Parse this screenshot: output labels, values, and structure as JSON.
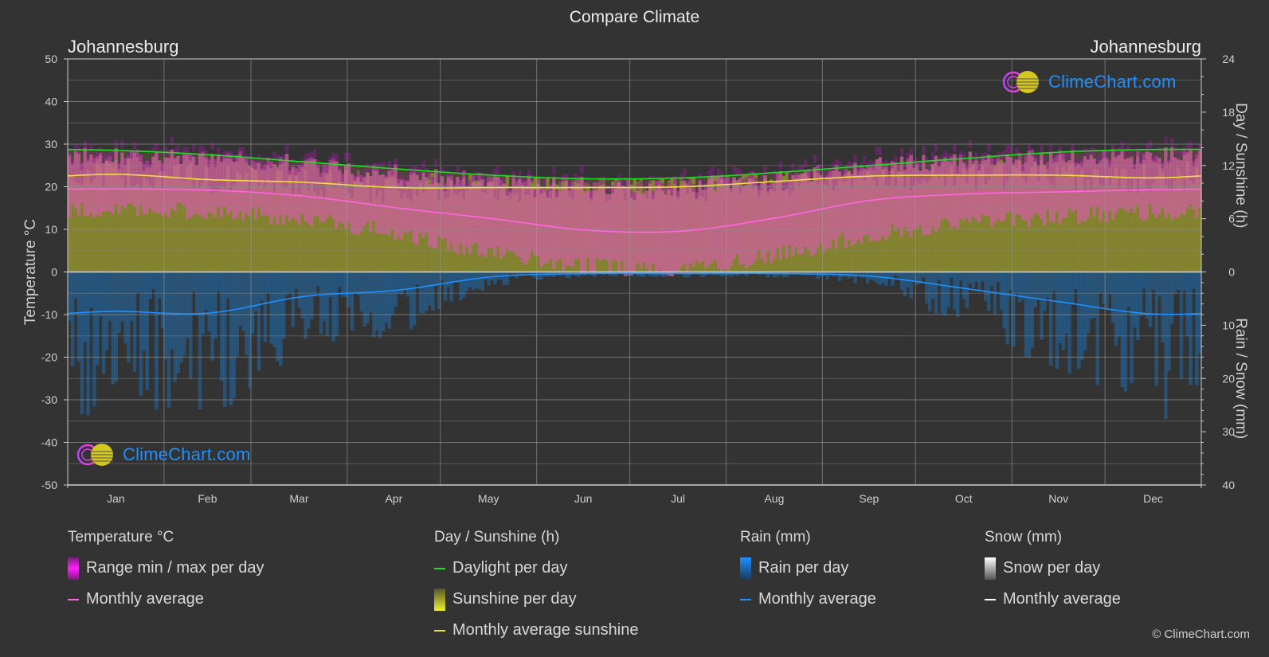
{
  "title": "Compare Climate",
  "city_left": "Johannesburg",
  "city_right": "Johannesburg",
  "watermark": "ClimeChart.com",
  "copyright": "© ClimeChart.com",
  "legend": {
    "temperature": {
      "title": "Temperature °C",
      "items": [
        {
          "label": "Range min / max per day",
          "color": "#e020e0"
        },
        {
          "label": "Monthly average",
          "color": "#ff66e0"
        }
      ]
    },
    "sunshine": {
      "title": "Day / Sunshine (h)",
      "items": [
        {
          "label": "Daylight per day",
          "color": "#22dd22"
        },
        {
          "label": "Sunshine per day",
          "color": "#e8e830"
        },
        {
          "label": "Monthly average sunshine",
          "color": "#f0e040"
        }
      ]
    },
    "rain": {
      "title": "Rain (mm)",
      "items": [
        {
          "label": "Rain per day",
          "color": "#1e90ff"
        },
        {
          "label": "Monthly average",
          "color": "#1e90ff"
        }
      ]
    },
    "snow": {
      "title": "Snow (mm)",
      "items": [
        {
          "label": "Snow per day",
          "color": "#ffffff"
        },
        {
          "label": "Monthly average",
          "color": "#ffffff"
        }
      ]
    }
  },
  "chart_data": {
    "type": "area",
    "title": "Compare Climate",
    "categories": [
      "Jan",
      "Feb",
      "Mar",
      "Apr",
      "May",
      "Jun",
      "Jul",
      "Aug",
      "Sep",
      "Oct",
      "Nov",
      "Dec"
    ],
    "y_left": {
      "label": "Temperature °C",
      "range": [
        -50,
        50
      ],
      "ticks": [
        50,
        40,
        30,
        20,
        10,
        0,
        -10,
        -20,
        -30,
        -40,
        -50
      ]
    },
    "y_right_top": {
      "label": "Day / Sunshine (h)",
      "range": [
        0,
        24
      ],
      "ticks": [
        24,
        18,
        12,
        6,
        0
      ]
    },
    "y_right_bottom": {
      "label": "Rain / Snow (mm)",
      "range": [
        0,
        40
      ],
      "ticks": [
        0,
        10,
        20,
        30,
        40
      ]
    },
    "grid": true,
    "series": [
      {
        "name": "Daylight per day (h)",
        "axis": "sunshine",
        "values": [
          13.7,
          13.2,
          12.4,
          11.6,
          10.9,
          10.5,
          10.6,
          11.2,
          12.0,
          12.8,
          13.5,
          13.8
        ]
      },
      {
        "name": "Monthly average sunshine (h)",
        "axis": "sunshine",
        "values": [
          11.0,
          10.4,
          10.1,
          9.5,
          9.5,
          9.5,
          9.6,
          10.2,
          10.8,
          10.9,
          10.9,
          10.6
        ]
      },
      {
        "name": "Temperature monthly average (°C)",
        "axis": "temperature",
        "values": [
          19.5,
          19.2,
          17.8,
          15.0,
          12.5,
          9.8,
          9.6,
          12.7,
          16.8,
          18.3,
          18.8,
          19.3
        ]
      },
      {
        "name": "Temperature daily max envelope (°C)",
        "axis": "temperature",
        "values": [
          26.5,
          26.0,
          24.8,
          22.5,
          20.5,
          19.5,
          19.5,
          21.5,
          24.0,
          25.5,
          26.0,
          26.5
        ]
      },
      {
        "name": "Temperature daily min envelope (°C)",
        "axis": "temperature",
        "values": [
          14.5,
          14.0,
          12.5,
          9.0,
          4.5,
          1.5,
          1.0,
          4.0,
          8.5,
          11.5,
          13.0,
          14.0
        ]
      },
      {
        "name": "Rain monthly average (mm)",
        "axis": "rain",
        "values": [
          7.4,
          7.7,
          4.6,
          3.4,
          0.9,
          0.3,
          0.3,
          0.3,
          0.8,
          3.1,
          5.6,
          7.9
        ]
      },
      {
        "name": "Snow monthly average (mm)",
        "axis": "rain",
        "values": [
          0,
          0,
          0,
          0,
          0,
          0,
          0,
          0,
          0,
          0,
          0,
          0
        ]
      }
    ]
  }
}
